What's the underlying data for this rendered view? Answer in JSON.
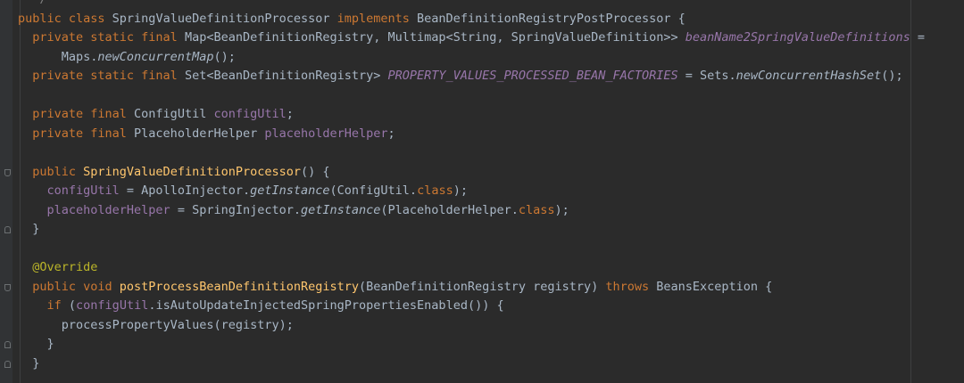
{
  "editor": {
    "colors": {
      "background": "#2b2b2b",
      "keyword": "#cc7832",
      "field": "#9876aa",
      "method": "#ffc66d",
      "annotation": "#bbb529",
      "text": "#a9b7c6"
    },
    "lines": [
      {
        "tokens": [
          {
            "t": "  */",
            "c": "cmt"
          }
        ]
      },
      {
        "tokens": [
          {
            "t": "public class ",
            "c": "kw"
          },
          {
            "t": "SpringValueDefinitionProcessor "
          },
          {
            "t": "implements ",
            "c": "kw"
          },
          {
            "t": "BeanDefinitionRegistryPostProcessor {"
          }
        ]
      },
      {
        "tokens": [
          {
            "t": "  private static final ",
            "c": "kw"
          },
          {
            "t": "Map<BeanDefinitionRegistry, Multimap<String, SpringValueDefinition>> "
          },
          {
            "t": "beanName2SpringValueDefinitions",
            "c": "sfld"
          },
          {
            "t": " ="
          }
        ]
      },
      {
        "tokens": [
          {
            "t": "      Maps."
          },
          {
            "t": "newConcurrentMap",
            "c": "it"
          },
          {
            "t": "();"
          }
        ]
      },
      {
        "tokens": [
          {
            "t": "  private static final ",
            "c": "kw"
          },
          {
            "t": "Set<BeanDefinitionRegistry> "
          },
          {
            "t": "PROPERTY_VALUES_PROCESSED_BEAN_FACTORIES",
            "c": "sfld"
          },
          {
            "t": " = Sets."
          },
          {
            "t": "newConcurrentHashSet",
            "c": "it"
          },
          {
            "t": "();"
          }
        ]
      },
      {
        "tokens": [
          {
            "t": ""
          }
        ]
      },
      {
        "tokens": [
          {
            "t": "  private final ",
            "c": "kw"
          },
          {
            "t": "ConfigUtil "
          },
          {
            "t": "configUtil",
            "c": "fld"
          },
          {
            "t": ";"
          }
        ]
      },
      {
        "tokens": [
          {
            "t": "  private final ",
            "c": "kw"
          },
          {
            "t": "PlaceholderHelper "
          },
          {
            "t": "placeholderHelper",
            "c": "fld"
          },
          {
            "t": ";"
          }
        ]
      },
      {
        "tokens": [
          {
            "t": ""
          }
        ]
      },
      {
        "tokens": [
          {
            "t": "  public ",
            "c": "kw"
          },
          {
            "t": "SpringValueDefinitionProcessor",
            "c": "fn"
          },
          {
            "t": "() {"
          }
        ]
      },
      {
        "tokens": [
          {
            "t": "    "
          },
          {
            "t": "configUtil",
            "c": "fld"
          },
          {
            "t": " = ApolloInjector."
          },
          {
            "t": "getInstance",
            "c": "it"
          },
          {
            "t": "(ConfigUtil."
          },
          {
            "t": "class",
            "c": "kw"
          },
          {
            "t": ");"
          }
        ]
      },
      {
        "tokens": [
          {
            "t": "    "
          },
          {
            "t": "placeholderHelper",
            "c": "fld"
          },
          {
            "t": " = SpringInjector."
          },
          {
            "t": "getInstance",
            "c": "it"
          },
          {
            "t": "(PlaceholderHelper."
          },
          {
            "t": "class",
            "c": "kw"
          },
          {
            "t": ");"
          }
        ]
      },
      {
        "tokens": [
          {
            "t": "  }"
          }
        ]
      },
      {
        "tokens": [
          {
            "t": ""
          }
        ]
      },
      {
        "tokens": [
          {
            "t": "  @Override",
            "c": "ann"
          }
        ]
      },
      {
        "tokens": [
          {
            "t": "  public void ",
            "c": "kw"
          },
          {
            "t": "postProcessBeanDefinitionRegistry",
            "c": "fn"
          },
          {
            "t": "(BeanDefinitionRegistry registry) "
          },
          {
            "t": "throws ",
            "c": "kw"
          },
          {
            "t": "BeansException {"
          }
        ]
      },
      {
        "tokens": [
          {
            "t": "    "
          },
          {
            "t": "if ",
            "c": "kw"
          },
          {
            "t": "("
          },
          {
            "t": "configUtil",
            "c": "fld"
          },
          {
            "t": ".isAutoUpdateInjectedSpringPropertiesEnabled()) {"
          }
        ]
      },
      {
        "tokens": [
          {
            "t": "      processPropertyValues(registry);"
          }
        ]
      },
      {
        "tokens": [
          {
            "t": "    }"
          }
        ]
      },
      {
        "tokens": [
          {
            "t": "  }"
          }
        ]
      }
    ],
    "fold_markers": [
      {
        "line": 9,
        "dir": "down"
      },
      {
        "line": 12,
        "dir": "up"
      },
      {
        "line": 15,
        "dir": "down"
      },
      {
        "line": 18,
        "dir": "up"
      },
      {
        "line": 19,
        "dir": "up"
      }
    ]
  }
}
